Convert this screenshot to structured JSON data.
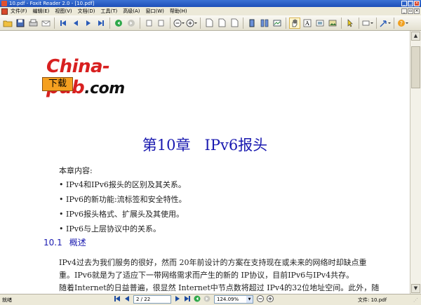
{
  "window": {
    "title": "10.pdf - Foxit Reader 2.0 - [10.pdf]",
    "minimize": "_",
    "maximize": "□",
    "close": "×"
  },
  "menu": [
    "文件(F)",
    "编辑(E)",
    "视图(V)",
    "文档(D)",
    "工具(T)",
    "高级(A)",
    "窗口(W)",
    "帮助(H)"
  ],
  "document": {
    "logo": "China-pub",
    "logo_suffix": ".com",
    "download": "下载",
    "chapter_num": "第10章",
    "chapter_title": "IPv6报头",
    "intro": "本章内容:",
    "bullets": [
      "• IPv4和IPv6报头的区别及其关系。",
      "• IPv6的新功能:流标签和安全特性。",
      "• IPv6报头格式、扩展头及其使用。",
      "• IPv6与上层协议中的关系。"
    ],
    "section_num": "10.1",
    "section_title": "概述",
    "paragraphs": [
      "IPv4过去为我们服务的很好，然而 20年前设计的方案在支持现在或未来的网络时却缺点重",
      "重。IPv6就是为了适应下一带网络需求而产生的新的 IP协议，目前IPv6与IPv4共存。",
      "随着Internet的日益普遍，很显然 Internet中节点数将超过 IPv4的32位地址空间。此外，随"
    ]
  },
  "status": {
    "ready": "就绪",
    "page": "2 / 22",
    "zoom": "124.09%",
    "file": "文件: 10.pdf"
  }
}
